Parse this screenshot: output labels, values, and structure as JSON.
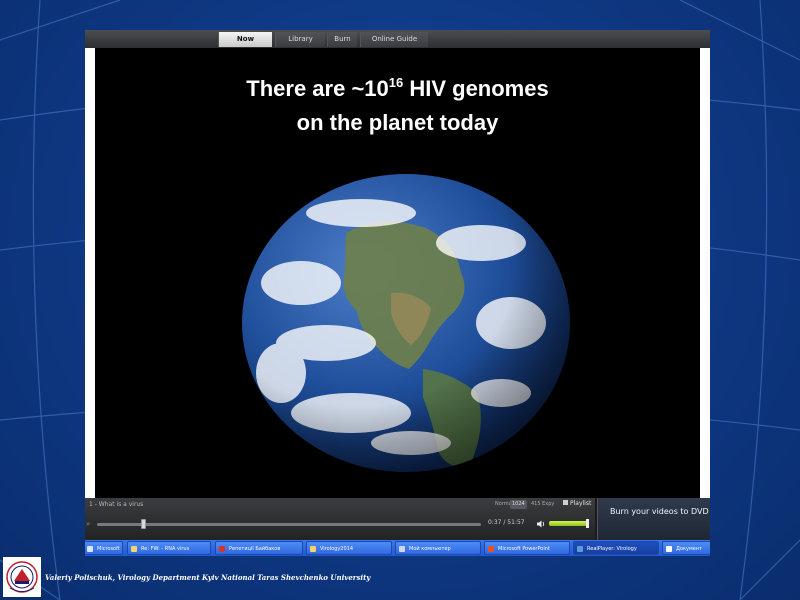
{
  "player": {
    "tabs": [
      {
        "label": "Now Playing",
        "active": true
      },
      {
        "label": "Library",
        "active": false
      },
      {
        "label": "Burn",
        "active": false
      },
      {
        "label": "Online Guide",
        "active": false
      }
    ],
    "video": {
      "title_prefix": "There are ~10",
      "title_sup": "16",
      "title_suffix": " HIV genomes",
      "title_line2": "on the planet today"
    },
    "controls": {
      "clip_name": "1 - What is a virus",
      "modes": [
        "Normal",
        "1024",
        "415 Expy"
      ],
      "selected_mode": "1024",
      "playlist_label": "Playlist",
      "time_readout": "0:37 / 51:57",
      "seek_fraction": 0.12,
      "volume_fraction": 0.95
    },
    "ad": {
      "text": "Burn your videos to DVD with"
    }
  },
  "taskbar": {
    "items": [
      {
        "label": "Microsoft",
        "active": false,
        "icon_color": "#d9e6ff"
      },
      {
        "label": "Re: FW: - RNA virus",
        "active": false,
        "icon_color": "#f3d36b"
      },
      {
        "label": "Репетиції Байбаков",
        "active": false,
        "icon_color": "#d8342b"
      },
      {
        "label": "Virology2014",
        "active": false,
        "icon_color": "#f3d36b"
      },
      {
        "label": "Мой компьютер",
        "active": false,
        "icon_color": "#cfd8e8"
      },
      {
        "label": "Microsoft PowerPoint",
        "active": false,
        "icon_color": "#e0542c"
      },
      {
        "label": "RealPlayer: Virology",
        "active": true,
        "icon_color": "#5a9bd8"
      },
      {
        "label": "Документ",
        "active": false,
        "icon_color": "#ffffff"
      }
    ]
  },
  "footer": {
    "text": "Valeriy Polischuk, Virology Department Kyiv National Taras Shevchenko University"
  },
  "colors": {
    "background": "#0f3a86",
    "taskbar": "#2b63d9",
    "volume": "#a8d62a"
  }
}
